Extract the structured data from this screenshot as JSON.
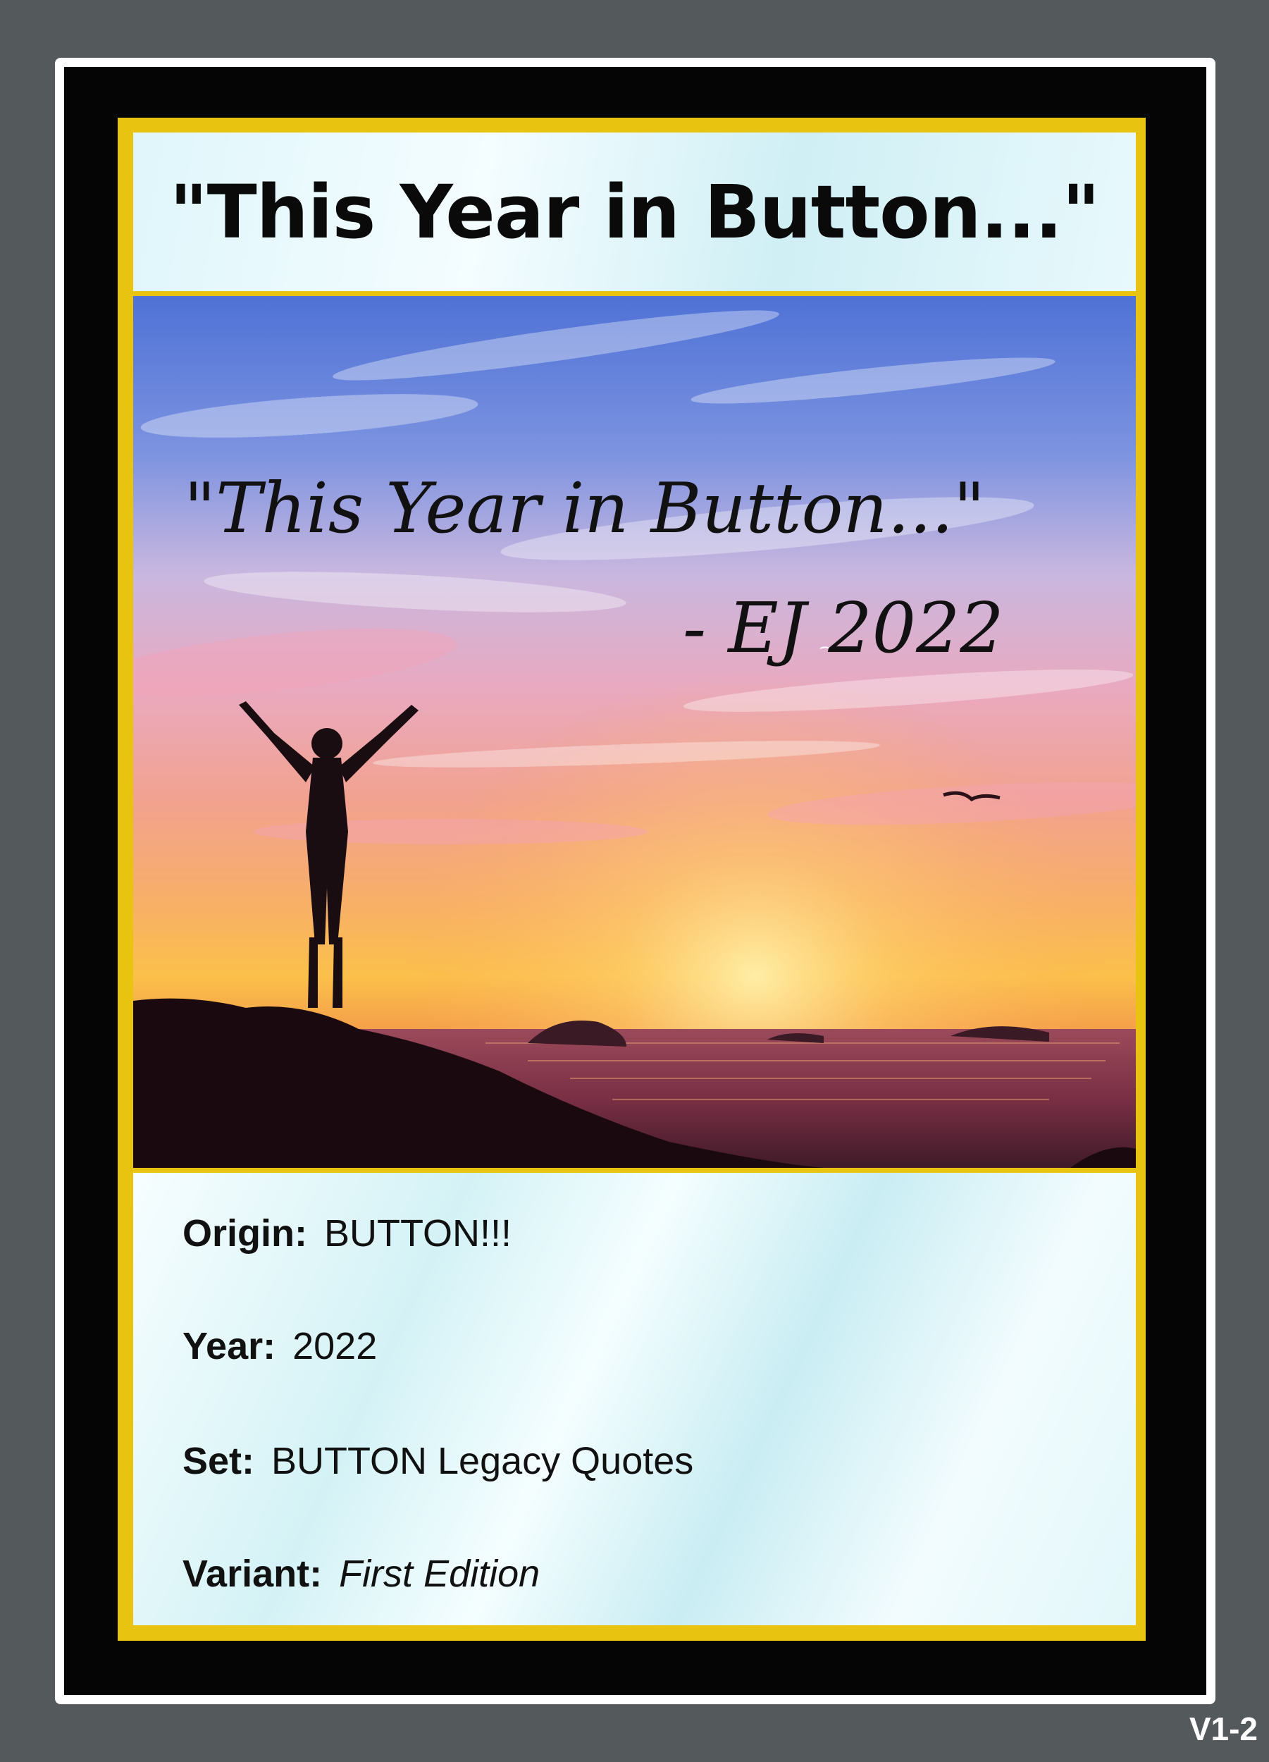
{
  "card": {
    "title": "\"This Year in Button...\"",
    "quote": {
      "text": "\"This Year in Button...\"",
      "attribution": "- EJ 2022"
    },
    "info": {
      "origin": {
        "label": "Origin:",
        "value": "BUTTON!!!"
      },
      "year": {
        "label": "Year:",
        "value": "2022"
      },
      "set": {
        "label": "Set:",
        "value": "BUTTON Legacy Quotes"
      },
      "variant": {
        "label": "Variant:",
        "value": "First Edition"
      }
    },
    "version": "V1-2"
  },
  "colors": {
    "background": "#54595c",
    "frame": "#050505",
    "gold": "#e8c410",
    "panel": "#dff6fb"
  },
  "artwork": {
    "description_icon": "sunset-silhouette-image"
  }
}
